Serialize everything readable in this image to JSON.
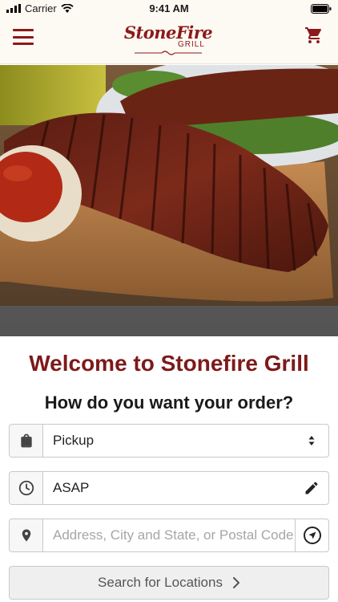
{
  "status_bar": {
    "carrier": "Carrier",
    "time": "9:41 AM"
  },
  "header": {
    "logo_main": "StoneFire",
    "logo_sub": "GRILL",
    "brand_color": "#8b1a1a"
  },
  "hero": {
    "icon": "steak-photo"
  },
  "main": {
    "welcome": "Welcome to Stonefire Grill",
    "question": "How do you want your order?",
    "order_type": {
      "value": "Pickup",
      "icon": "shopping-bag-icon"
    },
    "order_time": {
      "value": "ASAP",
      "icon": "clock-icon",
      "action_icon": "pencil-icon"
    },
    "address": {
      "placeholder": "Address, City and State, or Postal Code",
      "icon": "location-pin-icon",
      "action_icon": "navigation-arrow-icon"
    },
    "search_label": "Search for Locations"
  }
}
